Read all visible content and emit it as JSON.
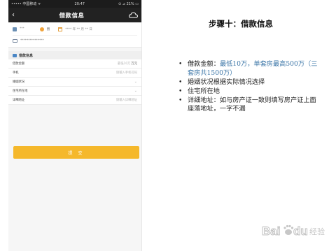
{
  "phone": {
    "status_bar": {
      "carrier": "••••• 中国移动 ᯤ",
      "time": "20:47",
      "battery": "⊙ ⊿ 21% ▭"
    },
    "nav": {
      "title": "借款信息",
      "back_icon": "chevron-left-icon",
      "right_icon": "cloud-icon"
    },
    "profile": {
      "name": "***",
      "gender": "男",
      "birth": "**** 年 ** 月 ** 日",
      "id_number": "***************"
    },
    "section_title": "借款信息",
    "form": [
      {
        "label": "借款金额",
        "value": "最低10万",
        "unit": "万元",
        "control": "text"
      },
      {
        "label": "手机",
        "value": "请输入手机号码",
        "unit": "",
        "control": "text"
      },
      {
        "label": "婚姻状况",
        "value": "",
        "unit": "",
        "control": "select"
      },
      {
        "label": "住宅所在地",
        "value": "",
        "unit": "",
        "control": "select"
      },
      {
        "label": "详细地址",
        "value": "请输入详细地址",
        "unit": "",
        "control": "text"
      }
    ],
    "submit_label": "提 交"
  },
  "slide": {
    "heading": "步骤十：借款信息",
    "bullets": [
      {
        "prefix": "借款金额：",
        "highlight": "最低10万，单套房最高500万（三套房共1500万）"
      },
      {
        "prefix": "婚姻状况根据实际情况选择",
        "highlight": ""
      },
      {
        "prefix": "住宅所在地",
        "highlight": ""
      },
      {
        "prefix": "详细地址：如与房产证一致则填写房产证上面座落地址，一字不漏",
        "highlight": ""
      }
    ]
  },
  "watermark": {
    "text": "Baidu 经验",
    "icon": "paw-icon"
  },
  "colors": {
    "accent_yellow": "#f5b82b",
    "nav_dark": "#222222",
    "highlight_blue": "#3f78a9"
  }
}
